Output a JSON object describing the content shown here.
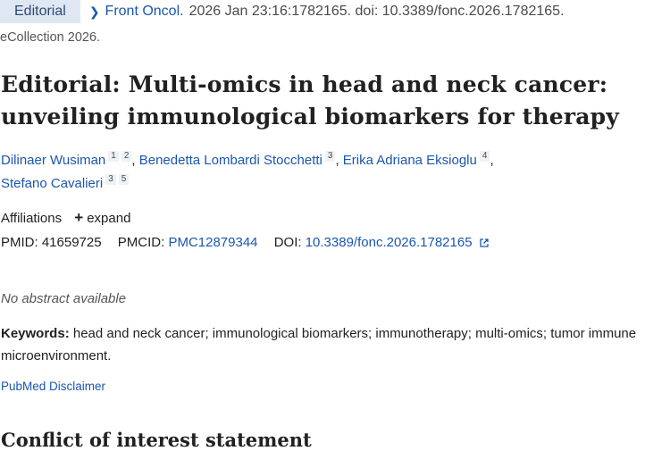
{
  "header": {
    "article_type": "Editorial",
    "journal": "Front Oncol.",
    "citation": "2026 Jan 23:16:1782165. doi: 10.3389/fonc.2026.1782165.",
    "ecollection": "eCollection 2026."
  },
  "title": "Editorial: Multi-omics in head and neck cancer: unveiling immunological biomarkers for therapy",
  "authors": [
    {
      "name": "Dilinaer Wusiman",
      "affils": [
        "1",
        "2"
      ]
    },
    {
      "name": "Benedetta Lombardi Stocchetti",
      "affils": [
        "3"
      ]
    },
    {
      "name": "Erika Adriana Eksioglu",
      "affils": [
        "4"
      ]
    },
    {
      "name": "Stefano Cavalieri",
      "affils": [
        "3",
        "5"
      ]
    }
  ],
  "affiliations": {
    "label": "Affiliations",
    "expand_label": "expand"
  },
  "identifiers": {
    "pmid_label": "PMID:",
    "pmid": "41659725",
    "pmcid_label": "PMCID:",
    "pmcid": "PMC12879344",
    "doi_label": "DOI:",
    "doi": "10.3389/fonc.2026.1782165"
  },
  "abstract_note": "No abstract available",
  "keywords": {
    "label": "Keywords:",
    "text": "head and neck cancer; immunological biomarkers; immunotherapy; multi-omics; tumor immune microenvironment."
  },
  "disclaimer_link": "PubMed Disclaimer",
  "section_heading": "Conflict of interest statement",
  "colors": {
    "link": "#1a56b0",
    "badge_bg": "#dfe7f2",
    "text": "#212121"
  }
}
